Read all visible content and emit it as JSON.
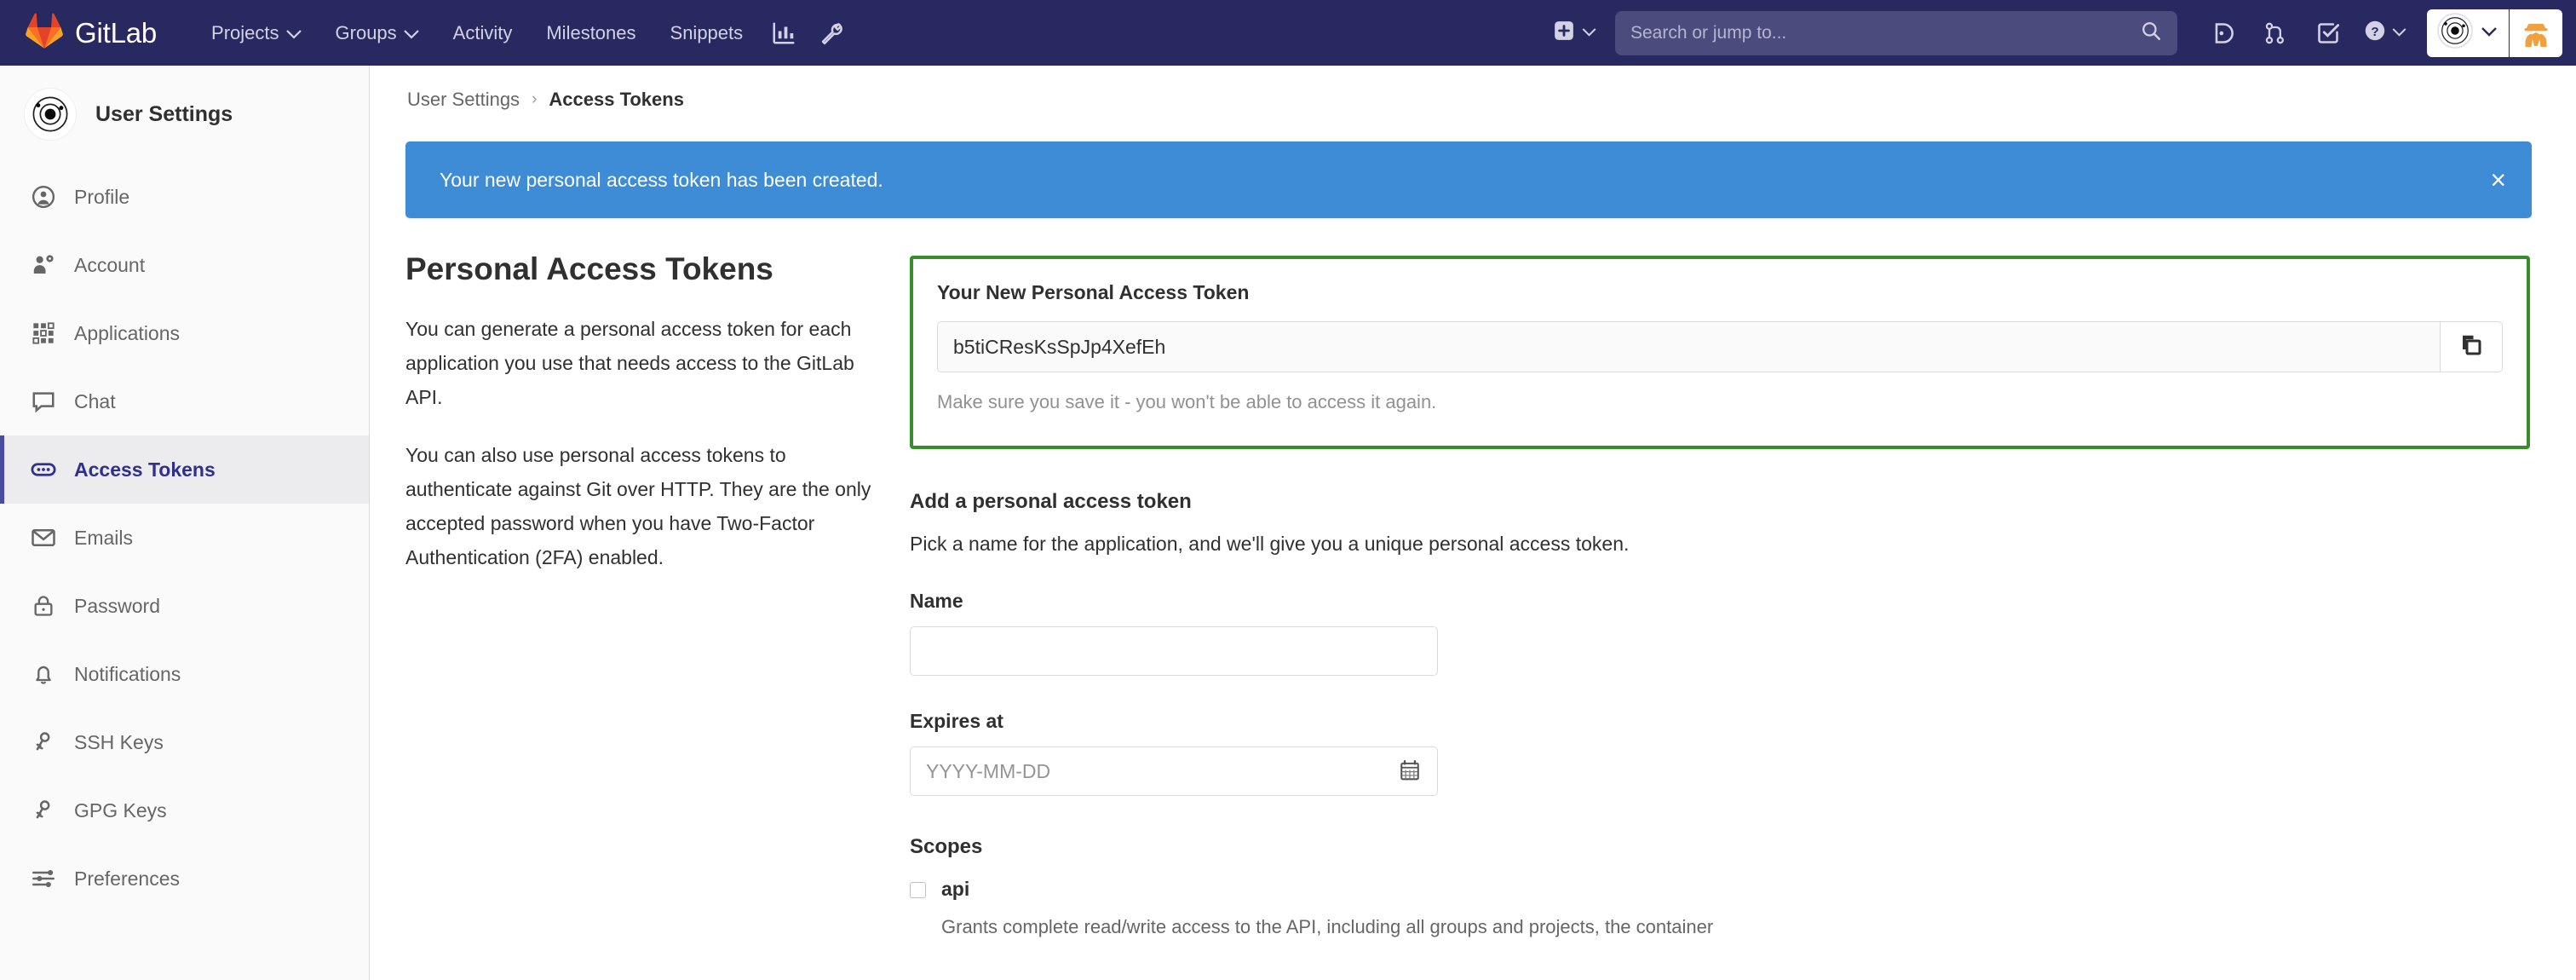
{
  "navbar": {
    "brand": "GitLab",
    "links": [
      {
        "label": "Projects",
        "has_caret": true
      },
      {
        "label": "Groups",
        "has_caret": true
      },
      {
        "label": "Activity",
        "has_caret": false
      },
      {
        "label": "Milestones",
        "has_caret": false
      },
      {
        "label": "Snippets",
        "has_caret": false
      }
    ],
    "icons": [
      "analytics-icon",
      "wrench-icon"
    ],
    "create_icon": "plus-square-icon",
    "search": {
      "placeholder": "Search or jump to...",
      "value": "",
      "icon": "search-icon"
    },
    "tools": [
      "issues-icon",
      "merge-requests-icon",
      "todos-icon"
    ],
    "help_icon": "question-circle-icon",
    "user_avatar_icon": "orbit-avatar-icon",
    "extension_icon": "incognito-spy-icon"
  },
  "sidebar": {
    "header_title": "User Settings",
    "header_avatar_icon": "orbit-avatar-icon",
    "items": [
      {
        "label": "Profile",
        "icon": "user-circle-icon",
        "active": false
      },
      {
        "label": "Account",
        "icon": "user-gear-icon",
        "active": false
      },
      {
        "label": "Applications",
        "icon": "grid-apps-icon",
        "active": false
      },
      {
        "label": "Chat",
        "icon": "comment-icon",
        "active": false
      },
      {
        "label": "Access Tokens",
        "icon": "token-pill-icon",
        "active": true
      },
      {
        "label": "Emails",
        "icon": "envelope-icon",
        "active": false
      },
      {
        "label": "Password",
        "icon": "lock-icon",
        "active": false
      },
      {
        "label": "Notifications",
        "icon": "bell-icon",
        "active": false
      },
      {
        "label": "SSH Keys",
        "icon": "key-icon",
        "active": false
      },
      {
        "label": "GPG Keys",
        "icon": "key-icon",
        "active": false
      },
      {
        "label": "Preferences",
        "icon": "sliders-icon",
        "active": false
      }
    ]
  },
  "breadcrumb": {
    "parent": "User Settings",
    "separator": "›",
    "current": "Access Tokens"
  },
  "alert": {
    "message": "Your new personal access token has been created.",
    "close_label": "×",
    "color": "#3d8cd5"
  },
  "left_column": {
    "title": "Personal Access Tokens",
    "paragraph1": "You can generate a personal access token for each application you use that needs access to the GitLab API.",
    "paragraph2": "You can also use personal access tokens to authenticate against Git over HTTP. They are the only accepted password when you have Two-Factor Authentication (2FA) enabled."
  },
  "token_card": {
    "label": "Your New Personal Access Token",
    "token_value": "b5tiCResKsSpJp4XefEh",
    "copy_icon": "copy-icon",
    "hint": "Make sure you save it - you won't be able to access it again.",
    "border_color": "#378d2c"
  },
  "add_token_form": {
    "section_title": "Add a personal access token",
    "section_desc": "Pick a name for the application, and we'll give you a unique personal access token.",
    "name_label": "Name",
    "name_value": "",
    "name_placeholder": "",
    "expires_label": "Expires at",
    "expires_value": "",
    "expires_placeholder": "YYYY-MM-DD",
    "calendar_icon": "calendar-icon",
    "scopes_label": "Scopes",
    "scopes": [
      {
        "name": "api",
        "checked": false,
        "description": "Grants complete read/write access to the API, including all groups and projects, the container"
      }
    ]
  }
}
